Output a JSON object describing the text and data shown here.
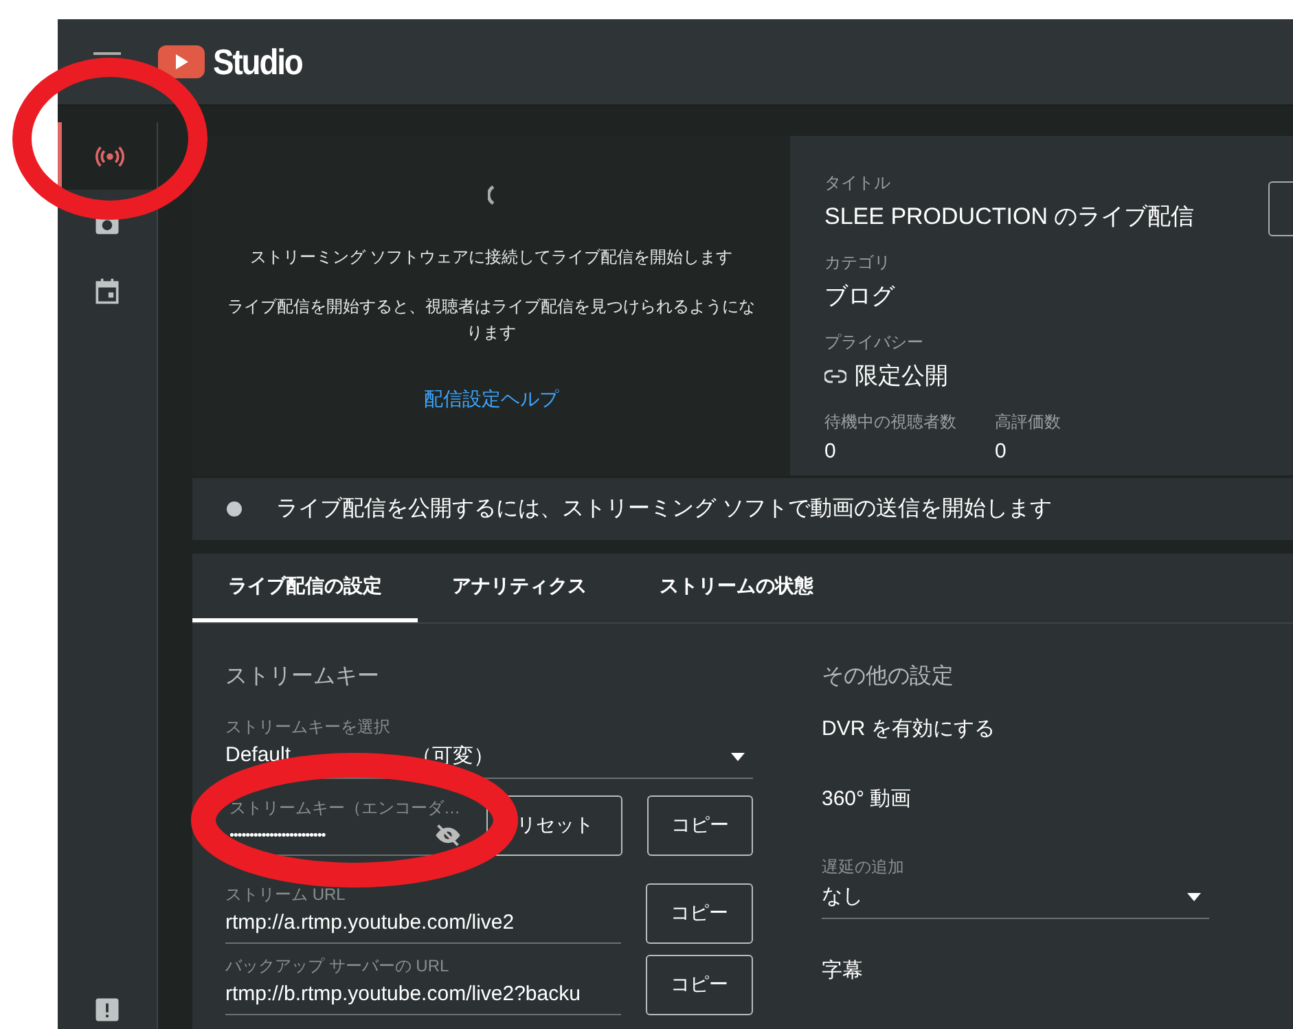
{
  "header": {
    "logo_text": "Studio"
  },
  "sidebar": {
    "items": [
      {
        "kind": "live",
        "selected": true
      },
      {
        "kind": "camera",
        "selected": false
      },
      {
        "kind": "calendar",
        "selected": false
      },
      {
        "kind": "feedback",
        "selected": false
      }
    ]
  },
  "preview": {
    "message": "ストリーミング ソフトウェアに接続してライブ配信を開始します",
    "note": "ライブ配信を開始すると、視聴者はライブ配信を見つけられるようになります",
    "help_link": "配信設定ヘルプ"
  },
  "details": {
    "fields": [
      {
        "kind": "text",
        "label": "タイトル",
        "value": "SLEE PRODUCTION のライブ配信"
      },
      {
        "kind": "text",
        "label": "カテゴリ",
        "value": "ブログ"
      },
      {
        "kind": "link",
        "label": "プライバシー",
        "value": "限定公開"
      }
    ],
    "stats": [
      {
        "label": "待機中の視聴者数",
        "value": "0"
      },
      {
        "label": "高評価数",
        "value": "0"
      }
    ]
  },
  "status": {
    "message": "ライブ配信を公開するには、ストリーミング ソフトで動画の送信を開始します"
  },
  "tabs": [
    {
      "label": "ライブ配信の設定",
      "selected": true
    },
    {
      "label": "アナリティクス",
      "selected": false
    },
    {
      "label": "ストリームの状態",
      "selected": false
    }
  ],
  "stream_key": {
    "heading": "ストリームキー",
    "select": {
      "label": "ストリームキーを選択",
      "value_parts": [
        "Default",
        "（可変）"
      ]
    },
    "key_field": {
      "label": "ストリームキー（エンコーダ…",
      "value": "••••••••••••••••••••••••",
      "reset_button": "リセット",
      "copy_button": "コピー"
    },
    "url_fields": [
      {
        "label": "ストリーム URL",
        "value": "rtmp://a.rtmp.youtube.com/live2",
        "copy_button": "コピー"
      },
      {
        "label": "バックアップ サーバーの URL",
        "value": "rtmp://b.rtmp.youtube.com/live2?backu",
        "copy_button": "コピー"
      }
    ]
  },
  "other_settings": {
    "heading": "その他の設定",
    "items": [
      {
        "kind": "option",
        "label": "DVR を有効にする"
      },
      {
        "kind": "option",
        "label": "360° 動画"
      },
      {
        "kind": "select",
        "label": "遅延の追加",
        "value": "なし"
      },
      {
        "kind": "option",
        "label": "字幕"
      }
    ]
  }
}
